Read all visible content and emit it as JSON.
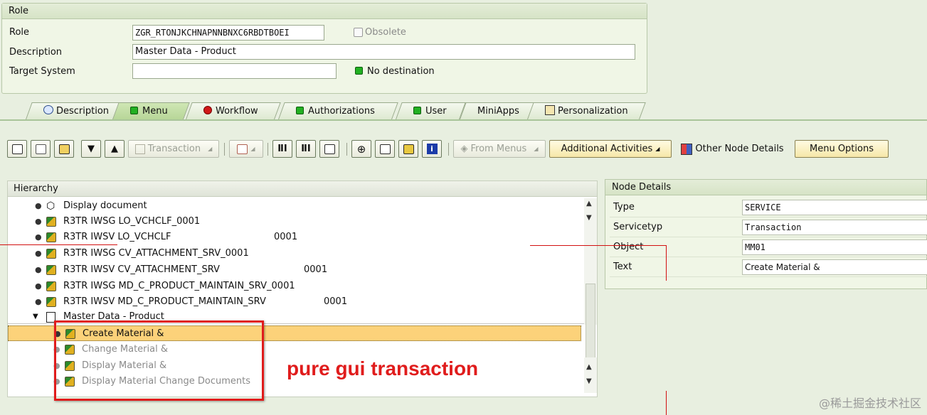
{
  "role_section": {
    "title": "Role",
    "role_label": "Role",
    "role_value": "ZGR_RTONJKCHNAPNNBNXC6RBDTBOEI",
    "obsolete_label": "Obsolete",
    "description_label": "Description",
    "description_value": "Master Data - Product",
    "target_label": "Target System",
    "target_value": "",
    "destination_status": "No destination"
  },
  "tabs": [
    {
      "label": "Description",
      "icon": "description-icon"
    },
    {
      "label": "Menu",
      "icon": "green-status-icon"
    },
    {
      "label": "Workflow",
      "icon": "red-status-icon"
    },
    {
      "label": "Authorizations",
      "icon": "green-status-icon"
    },
    {
      "label": "User",
      "icon": "green-status-icon"
    },
    {
      "label": "MiniApps",
      "icon": ""
    },
    {
      "label": "Personalization",
      "icon": "personalization-icon"
    }
  ],
  "toolbar": {
    "transaction_label": "Transaction",
    "from_menus_label": "From Menus",
    "additional_activities_label": "Additional Activities",
    "other_node_details_label": "Other Node Details",
    "menu_options_label": "Menu Options"
  },
  "hierarchy": {
    "title": "Hierarchy",
    "rows": [
      {
        "text": "Display document",
        "num": ""
      },
      {
        "text": "R3TR IWSG LO_VCHCLF_0001",
        "num": ""
      },
      {
        "text": "R3TR IWSV LO_VCHCLF",
        "num": "0001"
      },
      {
        "text": "R3TR IWSG CV_ATTACHMENT_SRV_0001",
        "num": ""
      },
      {
        "text": "R3TR IWSV CV_ATTACHMENT_SRV",
        "num": "0001"
      },
      {
        "text": "R3TR IWSG MD_C_PRODUCT_MAINTAIN_SRV_0001",
        "num": ""
      },
      {
        "text": "R3TR IWSV MD_C_PRODUCT_MAINTAIN_SRV",
        "num": "0001"
      },
      {
        "text": "Master Data - Product",
        "num": ""
      }
    ],
    "children": [
      {
        "text": "Create Material &"
      },
      {
        "text": "Change Material &"
      },
      {
        "text": "Display Material &"
      },
      {
        "text": "Display Material Change Documents"
      }
    ]
  },
  "node_details": {
    "title": "Node Details",
    "rows": [
      {
        "label": "Type",
        "value": "SERVICE"
      },
      {
        "label": "Servicetyp",
        "value": "Transaction"
      },
      {
        "label": "Object",
        "value": "MM01"
      },
      {
        "label": "Text",
        "value": "Create Material &"
      }
    ]
  },
  "annotation": "pure gui transaction",
  "watermark": "@稀土掘金技术社区",
  "colors": {
    "accent_red": "#e01c1c",
    "selected_row": "#fcd27a",
    "status_green": "#22b022"
  }
}
